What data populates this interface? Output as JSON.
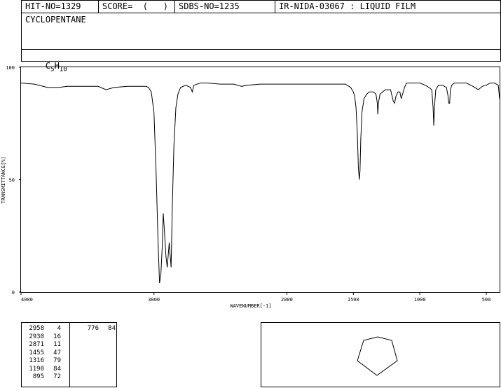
{
  "header": {
    "hit_no": "HIT-NO=1329",
    "score": "SCORE=  (   )",
    "sdbs_no": "SDBS-NO=1235",
    "sample_info": "IR-NIDA-03067 : LIQUID FILM"
  },
  "compound": {
    "name": "CYCLOPENTANE",
    "formula_c": "C",
    "formula_c_sub": "5",
    "formula_h": "H",
    "formula_h_sub": "10"
  },
  "chart_data": {
    "type": "line",
    "xlabel": "WAVENUMBER[-1]",
    "ylabel": "TRANSMITTANCE[%]",
    "xlim": [
      4000,
      400
    ],
    "ylim": [
      0,
      100
    ],
    "x_ticks": [
      "4000",
      "3000",
      "2000",
      "1500",
      "1000",
      "500"
    ],
    "x_tick_values": [
      4000,
      3000,
      2000,
      1500,
      1000,
      500
    ],
    "y_ticks": [
      "0",
      "50",
      "100"
    ],
    "y_tick_values": [
      0,
      50,
      100
    ],
    "series": [
      {
        "x": [
          4000,
          3900,
          3800,
          3720,
          3650,
          3500,
          3420,
          3360,
          3300,
          3200,
          3100,
          3060,
          3040,
          3020,
          3000,
          2985,
          2968,
          2958,
          2948,
          2938,
          2930,
          2920,
          2910,
          2900,
          2885,
          2871,
          2862,
          2850,
          2835,
          2820,
          2800,
          2760,
          2725,
          2712,
          2700,
          2650,
          2600,
          2500,
          2400,
          2340,
          2300,
          2200,
          2100,
          2000,
          1900,
          1800,
          1700,
          1620,
          1560,
          1520,
          1500,
          1490,
          1480,
          1470,
          1462,
          1455,
          1450,
          1444,
          1435,
          1420,
          1400,
          1380,
          1350,
          1330,
          1320,
          1316,
          1312,
          1300,
          1260,
          1220,
          1200,
          1190,
          1180,
          1165,
          1150,
          1140,
          1130,
          1115,
          1100,
          1050,
          1000,
          960,
          930,
          910,
          900,
          895,
          890,
          880,
          860,
          830,
          800,
          790,
          782,
          776,
          770,
          760,
          740,
          700,
          650,
          600,
          560,
          530,
          500,
          470,
          440,
          410,
          400
        ],
        "y": [
          93,
          92.5,
          91,
          91,
          91.5,
          91.5,
          91.5,
          90,
          91,
          91.5,
          91.5,
          91.5,
          91,
          89,
          80,
          55,
          20,
          4,
          8,
          20,
          35,
          26,
          16,
          11,
          22,
          11,
          38,
          65,
          82,
          88,
          91,
          92,
          91,
          89,
          92,
          93,
          93,
          92.5,
          92.5,
          91.5,
          92,
          92.5,
          92.5,
          92.5,
          92.5,
          92.5,
          92.5,
          92.5,
          92.5,
          91,
          89,
          87,
          82,
          70,
          55,
          50,
          54,
          68,
          80,
          86,
          88,
          89,
          89,
          88,
          84,
          79,
          84,
          88,
          90,
          90,
          85,
          84,
          87,
          89,
          89,
          86,
          88,
          91,
          93,
          93,
          93,
          92,
          91,
          90,
          82,
          74,
          82,
          90,
          92,
          92,
          91,
          88,
          84,
          84,
          90,
          92,
          93,
          93,
          93,
          91.5,
          90,
          91.5,
          92,
          93,
          93,
          92,
          86
        ]
      }
    ]
  },
  "peak_table": {
    "col1": [
      {
        "wavenumber": "2958",
        "intensity": "4"
      },
      {
        "wavenumber": "2930",
        "intensity": "16"
      },
      {
        "wavenumber": "2871",
        "intensity": "11"
      },
      {
        "wavenumber": "1455",
        "intensity": "47"
      },
      {
        "wavenumber": "1316",
        "intensity": "79"
      },
      {
        "wavenumber": "1190",
        "intensity": "84"
      },
      {
        "wavenumber": "895",
        "intensity": "72"
      }
    ],
    "col2": [
      {
        "wavenumber": "776",
        "intensity": "84"
      }
    ]
  },
  "structure": {
    "molecule": "cyclopentane-ring-icon"
  }
}
